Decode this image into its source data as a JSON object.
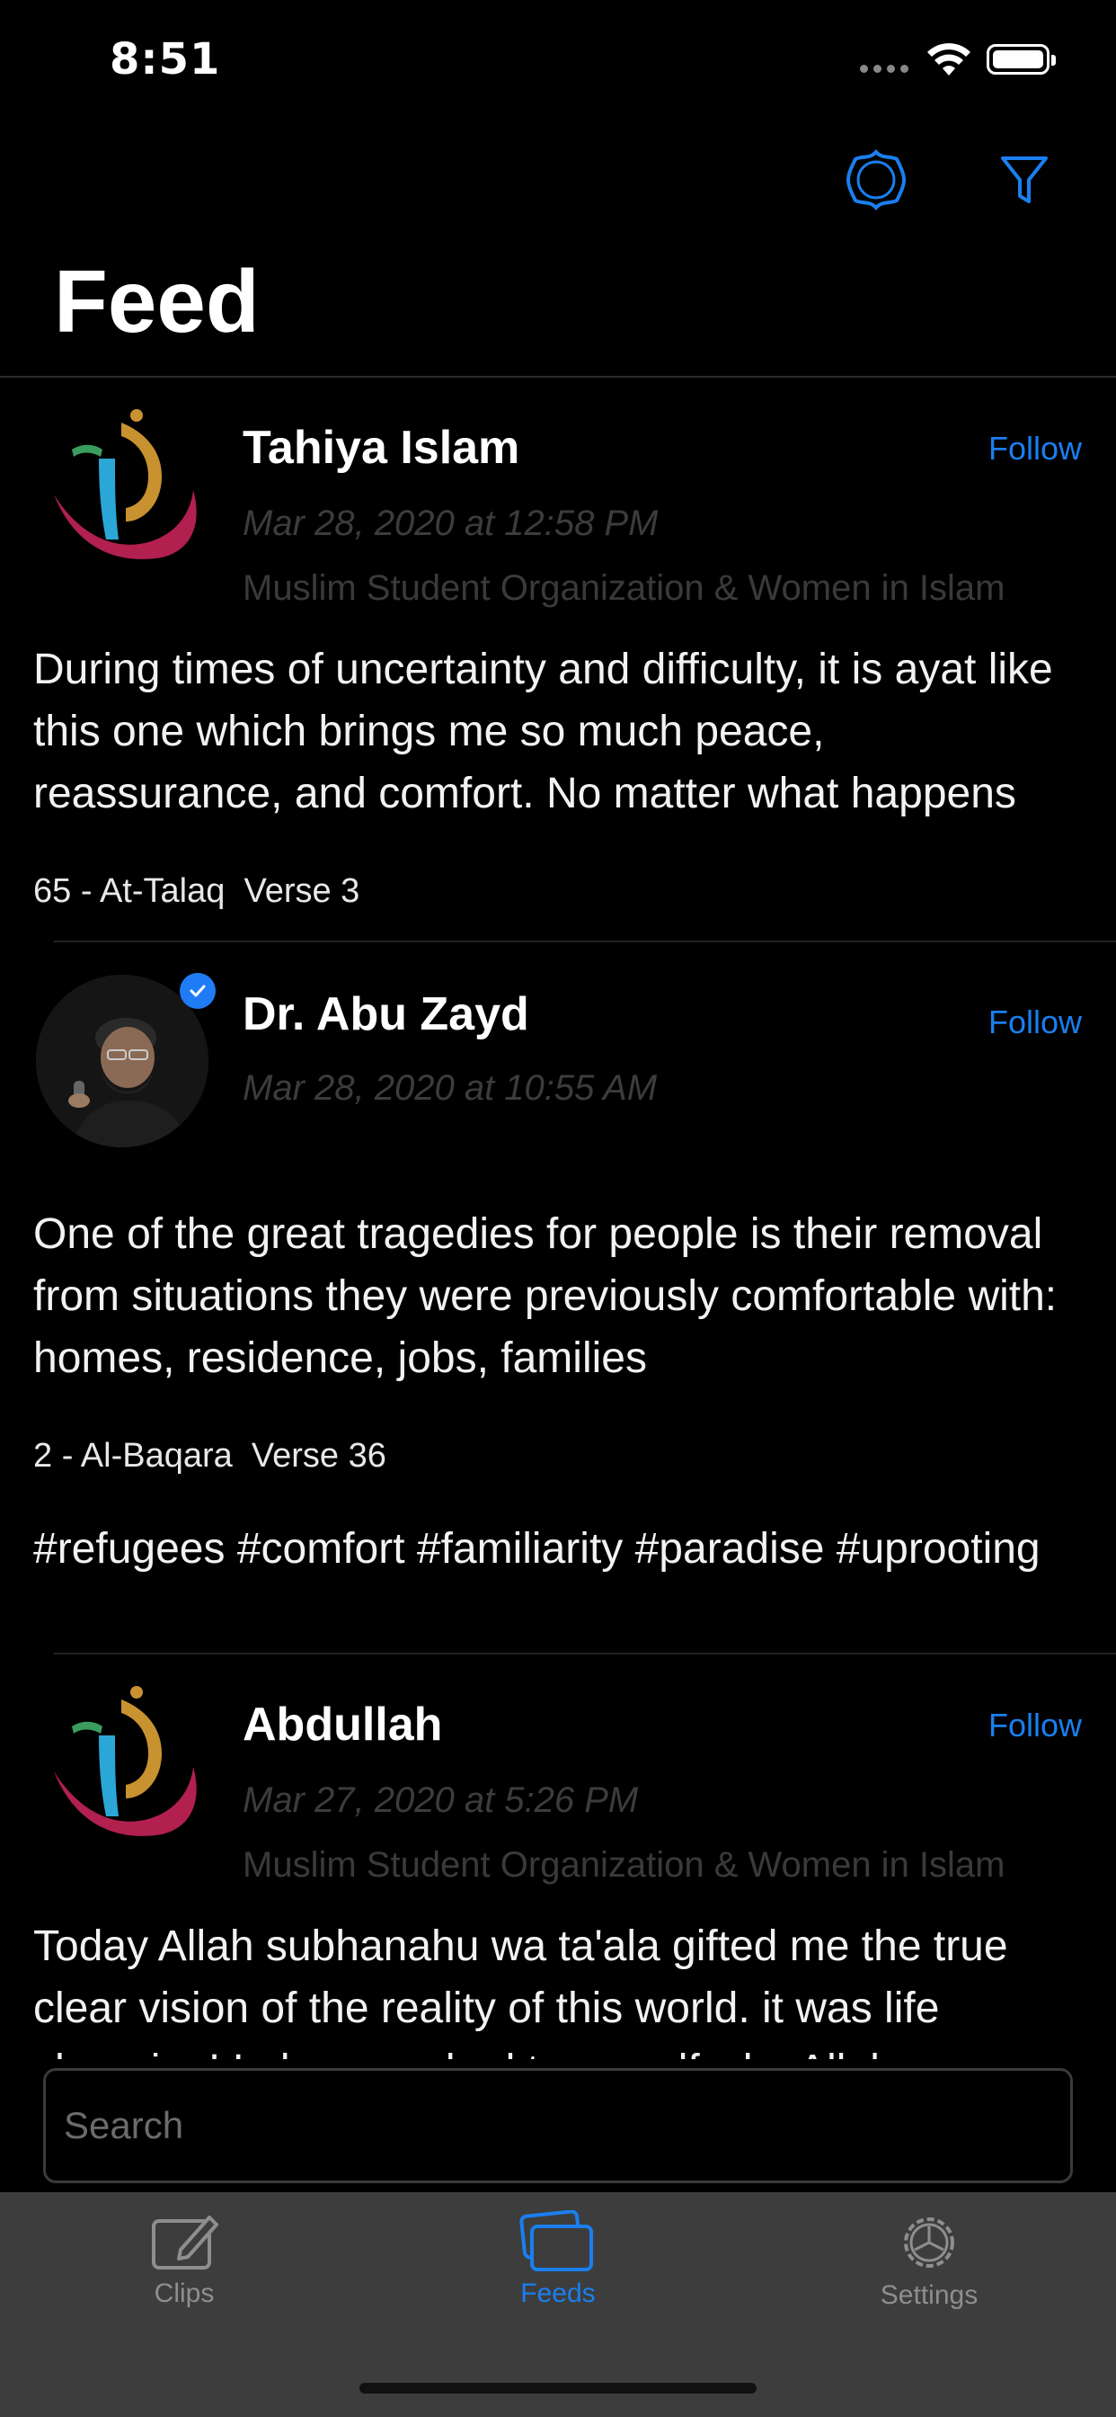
{
  "status_bar": {
    "time": "8:51"
  },
  "header": {
    "title": "Feed"
  },
  "posts": [
    {
      "author": "Tahiya Islam",
      "follow_label": "Follow",
      "date": "Mar 28, 2020 at 12:58 PM",
      "organization": "Muslim Student Organization & Women in Islam",
      "text": "During times of uncertainty and difficulty, it is ayat like this one which brings me so much peace, reassurance, and comfort. No matter what happens",
      "verse": "65 - At-Talaq  Verse 3",
      "avatar_icon": "quran-logo-icon"
    },
    {
      "author": "Dr. Abu Zayd",
      "follow_label": "Follow",
      "date": "Mar 28, 2020 at 10:55 AM",
      "verified": true,
      "text": "One of the great tragedies for people is their removal from situations they were previously comfortable with: homes, residence, jobs, families",
      "verse": "2 - Al-Baqara  Verse 36",
      "hashtags": "#refugees #comfort #familiarity #paradise #uprooting",
      "avatar_icon": "speaker-photo"
    },
    {
      "author": "Abdullah",
      "follow_label": "Follow",
      "date": "Mar 27, 2020 at 5:26 PM",
      "organization": "Muslim Student Organization & Women in Islam",
      "text": "Today Allah subhanahu wa ta'ala gifted me the true clear vision of the reality of this world. it was life changing! I always asked to myself why Allah",
      "avatar_icon": "quran-logo-icon"
    }
  ],
  "search": {
    "placeholder": "Search"
  },
  "tabs": [
    {
      "label": "Clips",
      "icon": "clip-edit-icon",
      "active": false
    },
    {
      "label": "Feeds",
      "icon": "cards-icon",
      "active": true
    },
    {
      "label": "Settings",
      "icon": "gear-icon",
      "active": false
    }
  ],
  "colors": {
    "accent": "#1A7FF0",
    "background": "#000000",
    "tab_bar": "#3D3D3D"
  }
}
